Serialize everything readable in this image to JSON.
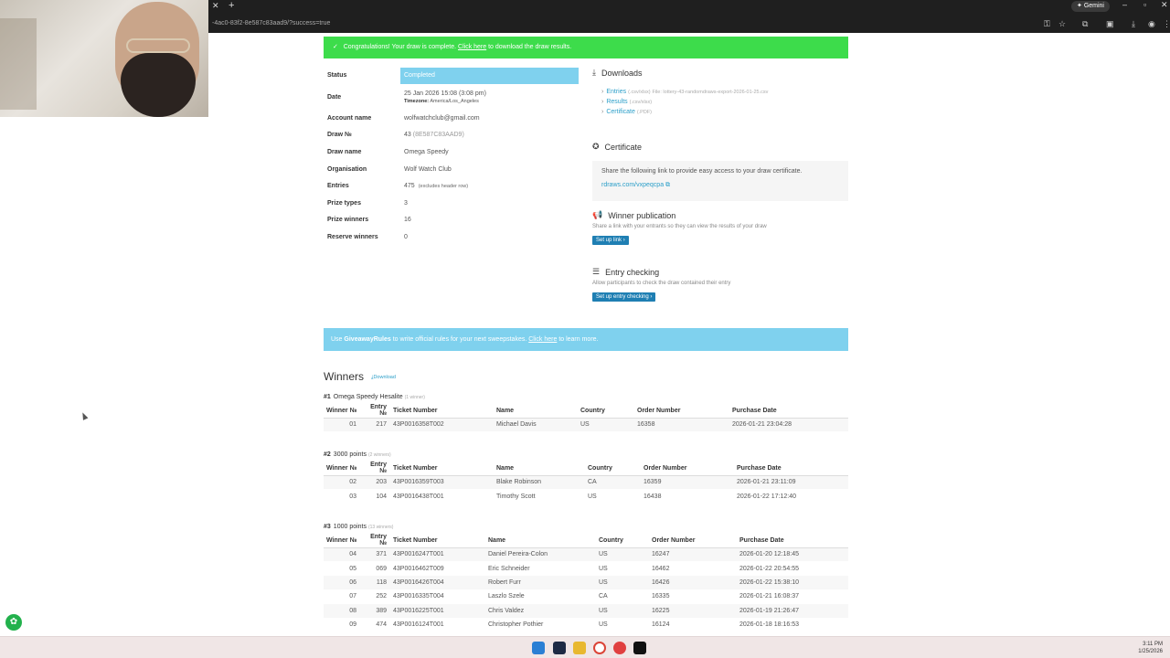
{
  "browser": {
    "url": "-4ac0-83f2-8e587c83aad9/?success=true",
    "gemini_label": "Gemini"
  },
  "banner": {
    "text": "Congratulations! Your draw is complete.",
    "link": "Click here",
    "suffix": "to download the draw results."
  },
  "details": {
    "status_label": "Status",
    "status_value": "Completed",
    "date_label": "Date",
    "date_value": "25 Jan 2026 15:08 (3:08 pm)",
    "timezone_label": "Timezone:",
    "timezone_value": "America/Los_Angeles",
    "account_label": "Account name",
    "account_value": "wolfwatchclub@gmail.com",
    "drawno_label": "Draw №",
    "drawno_value": "43",
    "drawno_id": "(8E587C83AAD9)",
    "drawname_label": "Draw name",
    "drawname_value": "Omega Speedy",
    "org_label": "Organisation",
    "org_value": "Wolf Watch Club",
    "entries_label": "Entries",
    "entries_value": "475",
    "entries_note": "(excludes header row)",
    "prizetypes_label": "Prize types",
    "prizetypes_value": "3",
    "prizewinners_label": "Prize winners",
    "prizewinners_value": "16",
    "reserve_label": "Reserve winners",
    "reserve_value": "0"
  },
  "downloads": {
    "title": "Downloads",
    "entries": "Entries",
    "entries_ext": "(.csv/xlsx)",
    "entries_file": "File: lottery-43-randomdraws-export-2026-01-25.csv",
    "results": "Results",
    "results_ext": "(.csv/xlsx)",
    "certificate": "Certificate",
    "certificate_ext": "(.PDF)"
  },
  "certificate": {
    "title": "Certificate",
    "text": "Share the following link to provide easy access to your draw certificate.",
    "link": "rdraws.com/vxpeqcpa"
  },
  "publication": {
    "title": "Winner publication",
    "text": "Share a link with your entrants so they can view the results of your draw",
    "button": "Set up link"
  },
  "entry_checking": {
    "title": "Entry checking",
    "text": "Allow participants to check the draw contained their entry",
    "button": "Set up entry checking"
  },
  "info": {
    "prefix": "Use",
    "brand": "GiveawayRules",
    "mid": "to write official rules for your next sweepstakes.",
    "link": "Click here",
    "suffix": "to learn more."
  },
  "winners": {
    "title": "Winners",
    "download": "Download",
    "columns": [
      "Winner №",
      "Entry №",
      "Ticket Number",
      "Name",
      "Country",
      "Order Number",
      "Purchase Date"
    ],
    "prizes": [
      {
        "num": "#1",
        "name": "Omega Speedy Hesalite",
        "count": "(1 winner)",
        "rows": [
          [
            "01",
            "217",
            "43P0016358T002",
            "Michael Davis",
            "US",
            "16358",
            "2026-01-21 23:04:28"
          ]
        ]
      },
      {
        "num": "#2",
        "name": "3000 points",
        "count": "(2 winners)",
        "rows": [
          [
            "02",
            "203",
            "43P0016359T003",
            "Blake Robinson",
            "CA",
            "16359",
            "2026-01-21 23:11:09"
          ],
          [
            "03",
            "104",
            "43P0016438T001",
            "Timothy Scott",
            "US",
            "16438",
            "2026-01-22 17:12:40"
          ]
        ]
      },
      {
        "num": "#3",
        "name": "1000 points",
        "count": "(13 winners)",
        "rows": [
          [
            "04",
            "371",
            "43P0016247T001",
            "Daniel Pereira-Colon",
            "US",
            "16247",
            "2026-01-20 12:18:45"
          ],
          [
            "05",
            "069",
            "43P0016462T009",
            "Eric Schneider",
            "US",
            "16462",
            "2026-01-22 20:54:55"
          ],
          [
            "06",
            "118",
            "43P0016426T004",
            "Robert Furr",
            "US",
            "16426",
            "2026-01-22 15:38:10"
          ],
          [
            "07",
            "252",
            "43P0016335T004",
            "Laszlo Szele",
            "CA",
            "16335",
            "2026-01-21 16:08:37"
          ],
          [
            "08",
            "389",
            "43P0016225T001",
            "Chris Valdez",
            "US",
            "16225",
            "2026-01-19 21:26:47"
          ],
          [
            "09",
            "474",
            "43P0016124T001",
            "Christopher Pothier",
            "US",
            "16124",
            "2026-01-18 18:16:53"
          ]
        ]
      }
    ]
  },
  "taskbar": {
    "time": "3:11 PM",
    "date": "1/25/2026"
  }
}
